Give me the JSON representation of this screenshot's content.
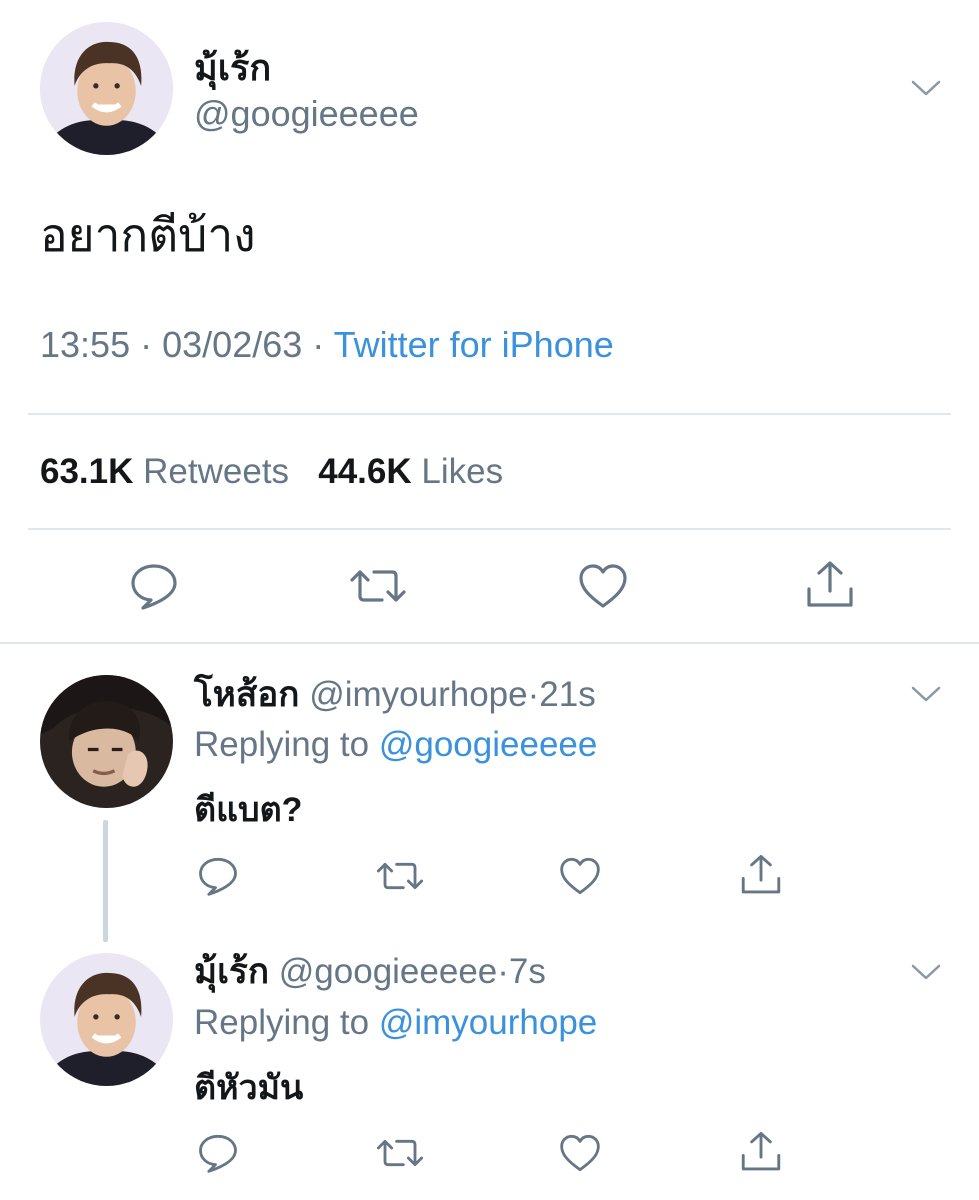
{
  "main_tweet": {
    "display_name": "มุ้เร้ก",
    "handle": "@googieeeee",
    "text": "อยากตีบ้าง",
    "time": "13:55",
    "date": "03/02/63",
    "separator": "·",
    "source": "Twitter for iPhone",
    "retweets_count": "63.1K",
    "retweets_label": "Retweets",
    "likes_count": "44.6K",
    "likes_label": "Likes"
  },
  "replies": [
    {
      "display_name": "โหส้อก",
      "handle": "@imyourhope",
      "separator": "·",
      "time": "21s",
      "replying_prefix": "Replying to",
      "replying_to": "@googieeeee",
      "text": "ตีแบต?"
    },
    {
      "display_name": "มุ้เร้ก",
      "handle": "@googieeeee",
      "separator": "·",
      "time": "7s",
      "replying_prefix": "Replying to",
      "replying_to": "@imyourhope",
      "text": "ตีหัวมัน"
    }
  ],
  "icons": {
    "reply": "comment-bubble-icon",
    "retweet": "retweet-arrows-icon",
    "like": "heart-icon",
    "share": "share-upload-icon",
    "menu": "chevron-down-icon"
  },
  "colors": {
    "text": "#14171a",
    "secondary": "#657786",
    "link": "#3a91dc",
    "divider": "#e1e8ed",
    "thread_line": "#ccd6dd"
  }
}
